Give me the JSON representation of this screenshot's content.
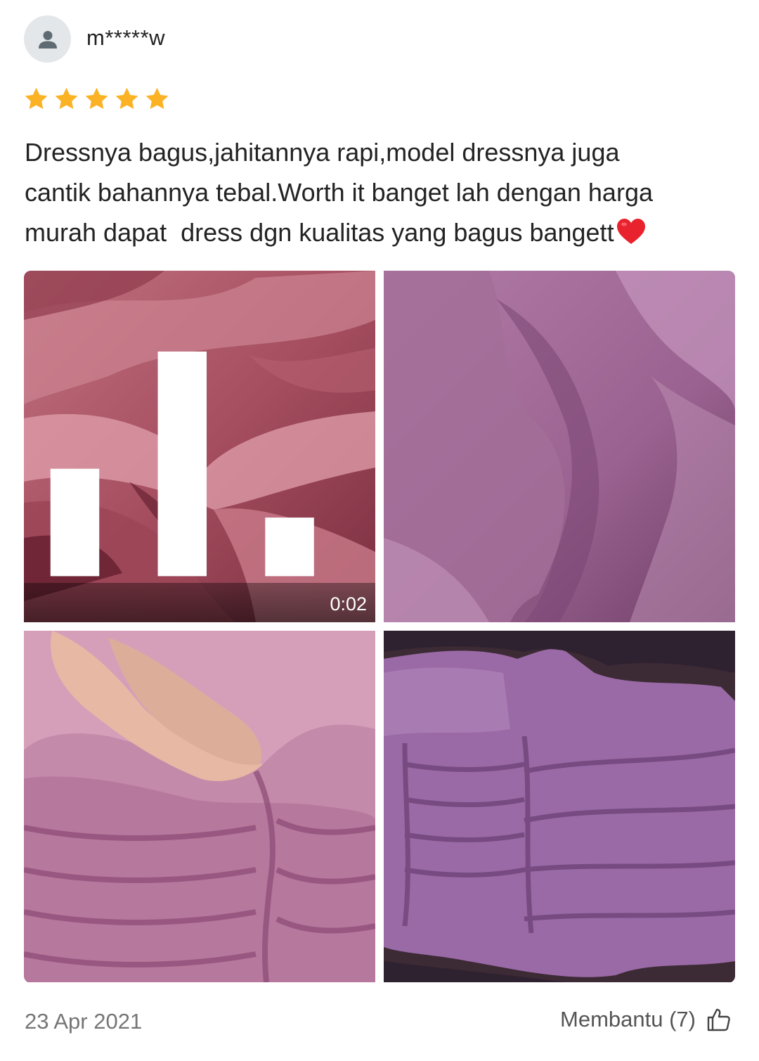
{
  "review": {
    "username": "m*****w",
    "avatar_icon": "user-silhouette-icon",
    "rating": 5,
    "rating_max": 5,
    "star_color": "#fbb224",
    "text": "Dressnya bagus,jahitannya rapi,model dressnya juga\ncantik bahannya tebal.Worth it banget lah dengan harga\nmurah dapat  dress dgn kualitas yang bagus bangett",
    "text_emoji": "red-heart-icon",
    "media": [
      {
        "type": "video",
        "duration": "0:02",
        "icon": "video-signal-icon"
      },
      {
        "type": "photo"
      },
      {
        "type": "photo"
      },
      {
        "type": "photo"
      }
    ],
    "date": "23 Apr 2021",
    "helpful_label": "Membantu (7)",
    "helpful_icon": "thumbs-up-outline-icon"
  }
}
